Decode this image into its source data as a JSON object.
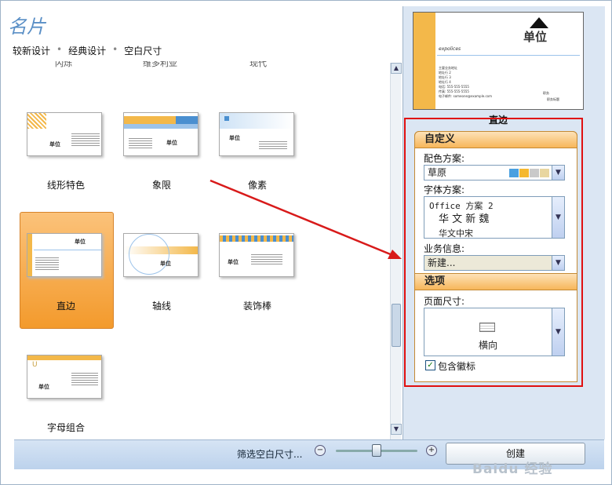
{
  "window": {
    "title": "名片"
  },
  "breadcrumb": {
    "items": [
      "较新设计",
      "经典设计",
      "空白尺寸"
    ],
    "separator": "•"
  },
  "cut_off_labels": [
    "闪烁",
    "维多利亚",
    "现代"
  ],
  "templates": [
    {
      "label": "线形特色"
    },
    {
      "label": "象限"
    },
    {
      "label": "像素"
    },
    {
      "label": "直边",
      "selected": true
    },
    {
      "label": "轴线"
    },
    {
      "label": "装饰棒"
    },
    {
      "label": "字母组合"
    }
  ],
  "card_text": {
    "company": "单位",
    "sample": "expolices",
    "preview_lines": [
      "主要业务地址",
      "地址行 2",
      "地址行 3",
      "地址行 4",
      "电话: 555-555-5555",
      "传真: 555-555-5555",
      "电子邮件: someone@example.com"
    ],
    "preview_right": [
      "职务",
      "职务标题"
    ]
  },
  "preview": {
    "name": "直边"
  },
  "customize": {
    "header": "自定义",
    "color_scheme_label": "配色方案:",
    "color_scheme_value": "草原",
    "color_swatches": [
      "#4aa0e0",
      "#f5b830",
      "#c9c9c9",
      "#e8d6a0"
    ],
    "font_scheme_label": "字体方案:",
    "font_scheme_lines": [
      "Office 方案 2",
      "华 文 新 魏",
      "华文中宋"
    ],
    "business_info_label": "业务信息:",
    "business_info_value": "新建..."
  },
  "options": {
    "header": "选项",
    "page_size_label": "页面尺寸:",
    "page_size_value": "横向",
    "include_logo_label": "包含徽标",
    "include_logo_checked": true
  },
  "bottom": {
    "filter_label": "筛选空白尺寸...",
    "create_label": "创建",
    "zoom_level": 0.5
  },
  "watermark": "Baidu 经验"
}
